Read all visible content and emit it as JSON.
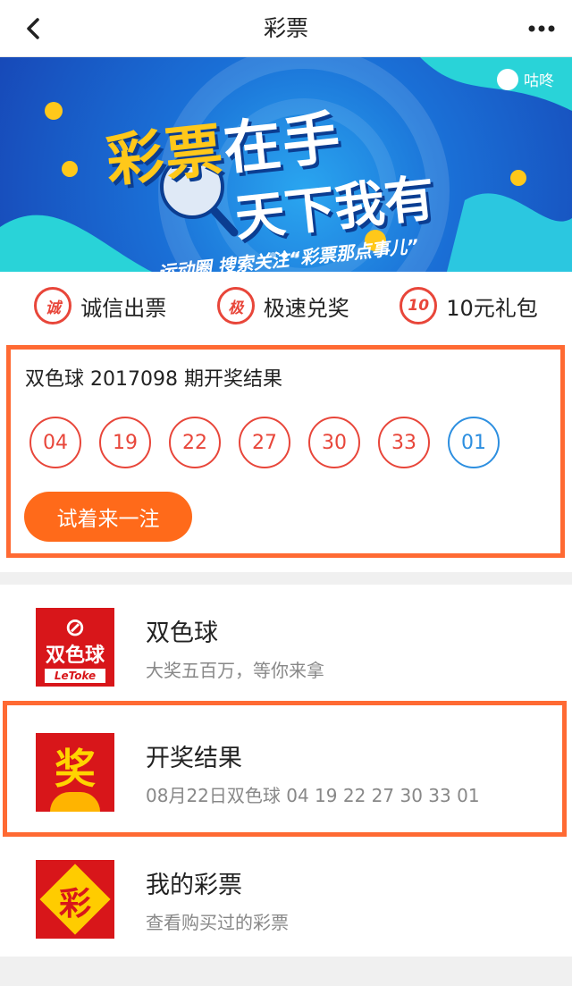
{
  "nav": {
    "title": "彩票",
    "back_icon": "chevron-left-icon",
    "more_icon": "more-dots-icon"
  },
  "banner": {
    "brand": "咕咚",
    "line1_highlight": "彩票",
    "line1_rest": "在手",
    "line2": "天下我有",
    "subtitle": "运动圈  搜索关注“彩票那点事儿”",
    "active_slide": 2,
    "slide_count": 3
  },
  "features": [
    {
      "icon_text": "诚",
      "label": "诚信出票"
    },
    {
      "icon_text": "极",
      "label": "极速兑奖"
    },
    {
      "icon_text": "10",
      "label": "10元礼包"
    }
  ],
  "result": {
    "title": "双色球 2017098 期开奖结果",
    "red_balls": [
      "04",
      "19",
      "22",
      "27",
      "30",
      "33"
    ],
    "blue_balls": [
      "01"
    ],
    "button_label": "试着来一注"
  },
  "list": [
    {
      "title": "双色球",
      "subtitle": "大奖五百万，等你来拿",
      "logo_top": "双色球",
      "logo_bottom": "LeToke"
    },
    {
      "title": "开奖结果",
      "subtitle": "08月22日双色球 04 19 22 27 30 33 01",
      "logo_text": "奖"
    },
    {
      "title": "我的彩票",
      "subtitle": "查看购买过的彩票",
      "logo_text": "彩"
    }
  ],
  "colors": {
    "accent": "#ff6a33",
    "red_ball": "#e8463a",
    "blue_ball": "#2d8fe0",
    "button": "#ff6a1a"
  }
}
